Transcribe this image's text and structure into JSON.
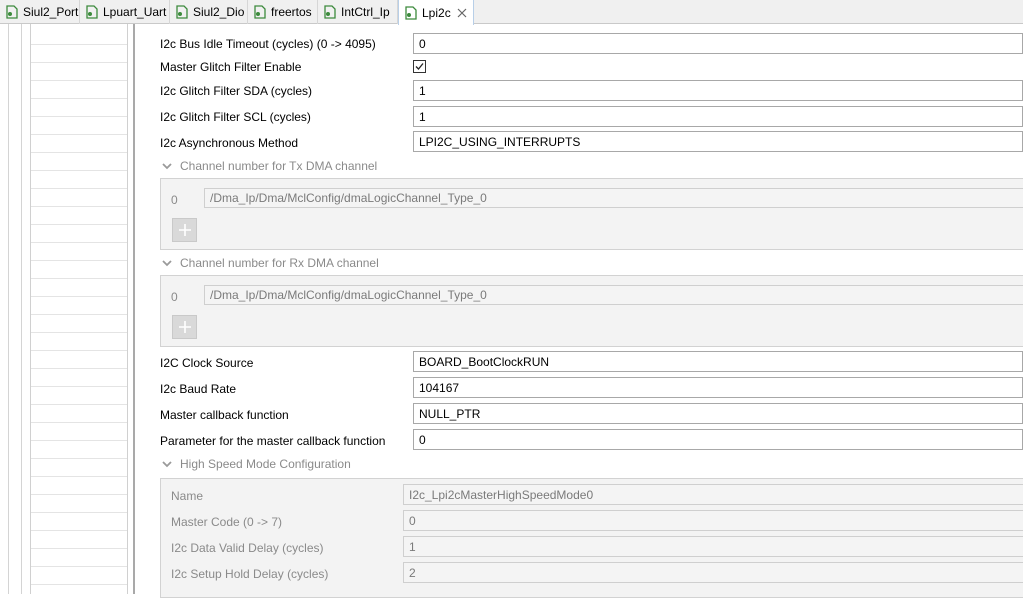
{
  "tabs": [
    {
      "label": "Siul2_Port"
    },
    {
      "label": "Lpuart_Uart"
    },
    {
      "label": "Siul2_Dio"
    },
    {
      "label": "freertos"
    },
    {
      "label": "IntCtrl_Ip"
    },
    {
      "label": "Lpi2c"
    }
  ],
  "form": {
    "bus_idle_timeout": {
      "label": "I2c Bus Idle Timeout (cycles) (0 -> 4095)",
      "value": "0"
    },
    "master_glitch_filter_enable": {
      "label": "Master Glitch Filter Enable",
      "checked": true
    },
    "glitch_filter_sda": {
      "label": "I2c Glitch Filter SDA (cycles)",
      "value": "1"
    },
    "glitch_filter_scl": {
      "label": "I2c Glitch Filter SCL (cycles)",
      "value": "1"
    },
    "async_method": {
      "label": "I2c Asynchronous Method",
      "value": "LPI2C_USING_INTERRUPTS"
    },
    "tx_dma": {
      "section_title": "Channel number for Tx DMA channel",
      "index": "0",
      "value": "/Dma_Ip/Dma/MclConfig/dmaLogicChannel_Type_0"
    },
    "rx_dma": {
      "section_title": "Channel number for Rx DMA channel",
      "index": "0",
      "value": "/Dma_Ip/Dma/MclConfig/dmaLogicChannel_Type_0"
    },
    "clock_source": {
      "label": "I2C Clock Source",
      "value": "BOARD_BootClockRUN"
    },
    "baud_rate": {
      "label": "I2c Baud Rate",
      "value": "104167"
    },
    "master_callback": {
      "label": "Master callback function",
      "value": "NULL_PTR"
    },
    "callback_param": {
      "label": "Parameter for the master callback function",
      "value": "0"
    },
    "high_speed": {
      "section_title": "High Speed Mode Configuration",
      "name": {
        "label": "Name",
        "value": "I2c_Lpi2cMasterHighSpeedMode0"
      },
      "master_code": {
        "label": "Master Code (0 -> 7)",
        "value": "0"
      },
      "data_valid_delay": {
        "label": "I2c Data Valid Delay (cycles)",
        "value": "1"
      },
      "setup_hold_delay": {
        "label": "I2c Setup Hold Delay (cycles)",
        "value": "2"
      }
    }
  },
  "colors": {
    "tab_icon_green": "#3c8a3c",
    "active_tab_border": "#b8cfe8",
    "disabled_text": "#8a8a8a"
  },
  "icons": {
    "tab": "config-file-icon",
    "close": "close-icon",
    "collapse": "chevron-down-icon",
    "add": "plus-icon",
    "checkbox": "checkmark-icon"
  }
}
